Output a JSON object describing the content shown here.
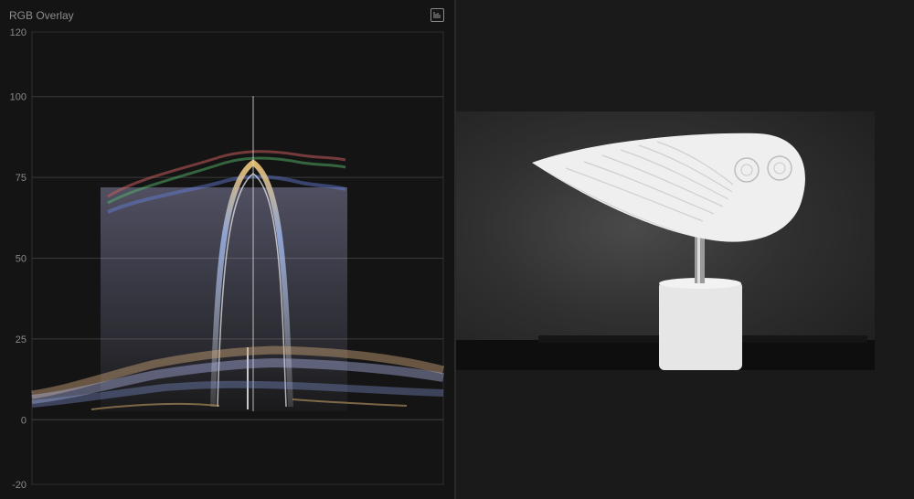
{
  "scope": {
    "title": "RGB Overlay",
    "settings_icon": "waveform-settings-icon",
    "scale_labels": [
      "120",
      "100",
      "75",
      "50",
      "25",
      "0",
      "-20"
    ],
    "scale_values": [
      120,
      100,
      75,
      50,
      25,
      0,
      -20
    ],
    "colors": {
      "red": "#e05a5a",
      "green": "#5fd07a",
      "blue": "#6a8cff",
      "grid": "#3a3a3a"
    }
  },
  "viewer": {
    "image_subject": "white marble owl sculpture on cylindrical base"
  }
}
